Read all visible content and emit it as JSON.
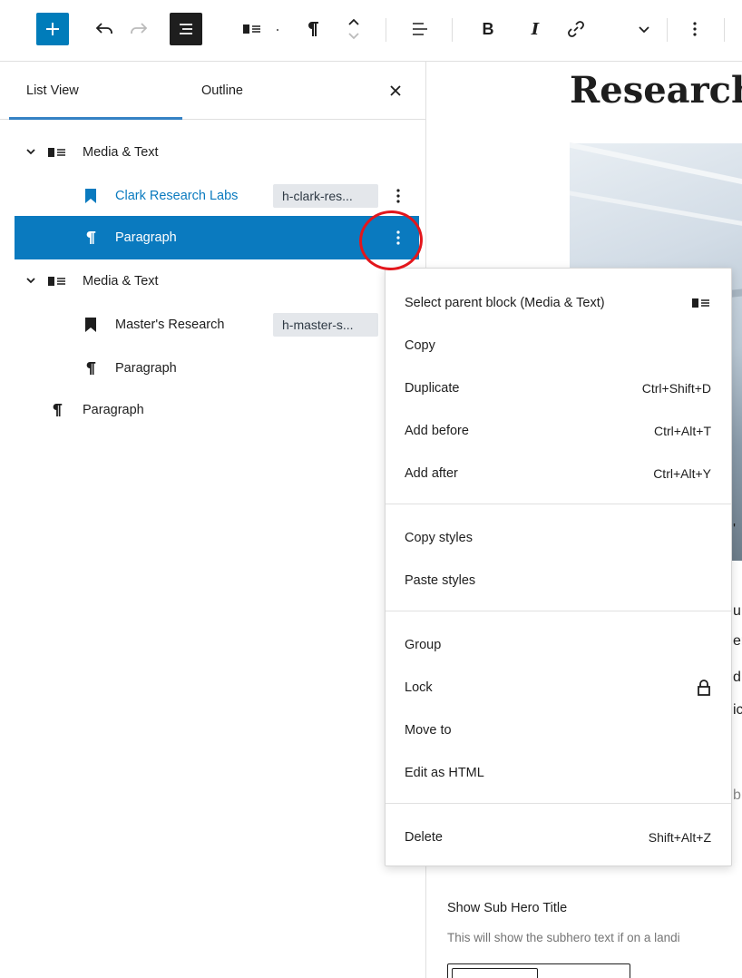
{
  "toolbar": {
    "icons": [
      "plus-icon",
      "undo-icon",
      "redo-icon",
      "document-overview-icon",
      "media-text-icon",
      "paragraph-icon",
      "move-up-down-icon",
      "align-icon",
      "bold-icon",
      "italic-icon",
      "link-icon",
      "chevron-down-icon",
      "more-options-icon"
    ],
    "bold_label": "B",
    "italic_label": "I",
    "dot": "·",
    "accent": "#007cba"
  },
  "panel": {
    "tabs": [
      {
        "label": "List View",
        "active": true
      },
      {
        "label": "Outline",
        "active": false
      }
    ],
    "close_label": "×",
    "items": [
      {
        "label": "Media & Text",
        "icon": "media-text-icon",
        "expandable": true
      },
      {
        "label": "Clark Research Labs",
        "icon": "bookmark-icon",
        "anchor": "h-clark-res...",
        "link_color": "#0a7abf"
      },
      {
        "label": "Paragraph",
        "icon": "paragraph-icon",
        "selected": true
      },
      {
        "label": "Media & Text",
        "icon": "media-text-icon",
        "expandable": true
      },
      {
        "label": "Master's Research",
        "icon": "bookmark-icon",
        "anchor": "h-master-s..."
      },
      {
        "label": "Paragraph",
        "icon": "paragraph-icon"
      },
      {
        "label": "Paragraph",
        "icon": "paragraph-icon"
      }
    ],
    "selected_color": "#0a7abf"
  },
  "canvas": {
    "page_title": "Research",
    "fragments": [
      "'",
      "u",
      "er",
      "d",
      "ic",
      "b"
    ],
    "sub_hero_title": "Show Sub Hero Title",
    "sub_hero_desc": "This will show the subhero text if on a landi"
  },
  "menu": {
    "groups": [
      [
        {
          "label": "Select parent block (Media & Text)",
          "icon": "media-text-icon"
        },
        {
          "label": "Copy"
        },
        {
          "label": "Duplicate",
          "shortcut": "Ctrl+Shift+D"
        },
        {
          "label": "Add before",
          "shortcut": "Ctrl+Alt+T"
        },
        {
          "label": "Add after",
          "shortcut": "Ctrl+Alt+Y"
        }
      ],
      [
        {
          "label": "Copy styles"
        },
        {
          "label": "Paste styles"
        }
      ],
      [
        {
          "label": "Group"
        },
        {
          "label": "Lock",
          "icon": "lock-icon"
        },
        {
          "label": "Move to"
        },
        {
          "label": "Edit as HTML"
        }
      ],
      [
        {
          "label": "Delete",
          "shortcut": "Shift+Alt+Z"
        }
      ]
    ]
  },
  "annotation_color": "#e3161c"
}
